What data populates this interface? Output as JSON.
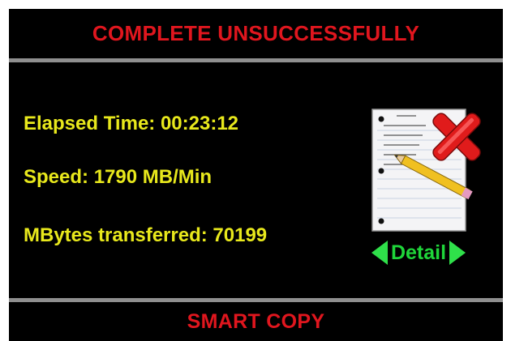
{
  "header": {
    "title": "COMPLETE UNSUCCESSFULLY"
  },
  "stats": {
    "elapsed_label": "Elapsed Time:",
    "elapsed_value": "00:23:12",
    "speed_label": "Speed:",
    "speed_value": "1790 MB/Min",
    "mbytes_label": "MBytes transferred:",
    "mbytes_value": "70199"
  },
  "detail": {
    "label": "Detail"
  },
  "footer": {
    "label": "SMART COPY"
  },
  "icons": {
    "status": "document-with-red-x-icon",
    "prev": "green-left-arrow-icon",
    "next": "green-right-arrow-icon"
  },
  "colors": {
    "background": "#000000",
    "title": "#e0161e",
    "stat_text": "#e8e81c",
    "detail": "#1fd63a",
    "divider": "#8f8f8f"
  }
}
